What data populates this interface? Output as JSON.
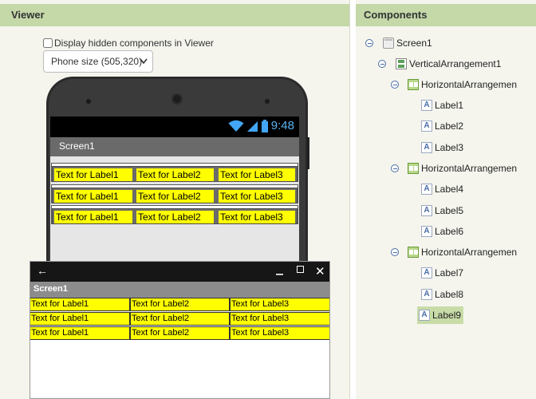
{
  "viewer": {
    "title": "Viewer",
    "hidden_checkbox_label": "Display hidden components in Viewer",
    "size_select": "Phone size (505,320)",
    "phone": {
      "time": "9:48",
      "screen_title": "Screen1",
      "rows": [
        [
          "Text for Label1",
          "Text for Label2",
          "Text for Label3"
        ],
        [
          "Text for Label1",
          "Text for Label2",
          "Text for Label3"
        ],
        [
          "Text for Label1",
          "Text for Label2",
          "Text for Label3"
        ]
      ]
    },
    "window": {
      "back": "←",
      "minimize": "—",
      "close": "✕",
      "screen_title": "Screen1",
      "rows": [
        [
          "Text for Label1",
          "Text for Label2",
          "Text for Label3"
        ],
        [
          "Text for Label1",
          "Text for Label2",
          "Text for Label3"
        ],
        [
          "Text for Label1",
          "Text for Label2",
          "Text for Label3"
        ]
      ]
    }
  },
  "components": {
    "title": "Components",
    "tree": [
      {
        "label": "Screen1",
        "icon": "screen-icon"
      },
      {
        "label": "VerticalArrangement1",
        "icon": "vertical-arrangement-icon"
      },
      {
        "label": "HorizontalArrangemen",
        "icon": "horizontal-arrangement-icon"
      },
      {
        "label": "Label1",
        "icon": "label-icon"
      },
      {
        "label": "Label2",
        "icon": "label-icon"
      },
      {
        "label": "Label3",
        "icon": "label-icon"
      },
      {
        "label": "HorizontalArrangemen",
        "icon": "horizontal-arrangement-icon"
      },
      {
        "label": "Label4",
        "icon": "label-icon"
      },
      {
        "label": "Label5",
        "icon": "label-icon"
      },
      {
        "label": "Label6",
        "icon": "label-icon"
      },
      {
        "label": "HorizontalArrangemen",
        "icon": "horizontal-arrangement-icon"
      },
      {
        "label": "Label7",
        "icon": "label-icon"
      },
      {
        "label": "Label8",
        "icon": "label-icon"
      },
      {
        "label": "Label9",
        "icon": "label-icon"
      }
    ],
    "selected": "Label9",
    "label_icon_glyph": "A"
  },
  "colors": {
    "header": "#c4d8a8",
    "label_background": "#ffff00",
    "selected": "#c8dca8",
    "clock": "#5bb4f2"
  }
}
